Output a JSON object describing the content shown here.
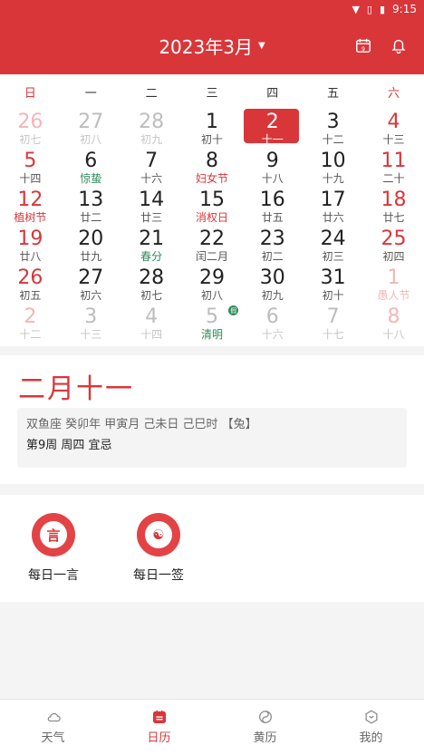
{
  "status_bar": {
    "time": "9:15"
  },
  "header": {
    "title": "2023年3月"
  },
  "weekdays": [
    "日",
    "一",
    "二",
    "三",
    "四",
    "五",
    "六"
  ],
  "calendar": {
    "rows": [
      [
        {
          "d": "26",
          "l": "初七",
          "other": true
        },
        {
          "d": "27",
          "l": "初八",
          "other": true
        },
        {
          "d": "28",
          "l": "初九",
          "other": true
        },
        {
          "d": "1",
          "l": "初十"
        },
        {
          "d": "2",
          "l": "十一",
          "selected": true
        },
        {
          "d": "3",
          "l": "十二"
        },
        {
          "d": "4",
          "l": "十三"
        }
      ],
      [
        {
          "d": "5",
          "l": "十四"
        },
        {
          "d": "6",
          "l": "惊蛰",
          "fest": "green"
        },
        {
          "d": "7",
          "l": "十六"
        },
        {
          "d": "8",
          "l": "妇女节",
          "fest": "red"
        },
        {
          "d": "9",
          "l": "十八"
        },
        {
          "d": "10",
          "l": "十九"
        },
        {
          "d": "11",
          "l": "二十"
        }
      ],
      [
        {
          "d": "12",
          "l": "植树节",
          "fest": "red"
        },
        {
          "d": "13",
          "l": "廿二"
        },
        {
          "d": "14",
          "l": "廿三"
        },
        {
          "d": "15",
          "l": "消权日",
          "fest": "red"
        },
        {
          "d": "16",
          "l": "廿五"
        },
        {
          "d": "17",
          "l": "廿六"
        },
        {
          "d": "18",
          "l": "廿七"
        }
      ],
      [
        {
          "d": "19",
          "l": "廿八"
        },
        {
          "d": "20",
          "l": "廿九"
        },
        {
          "d": "21",
          "l": "春分",
          "fest": "green"
        },
        {
          "d": "22",
          "l": "闰二月"
        },
        {
          "d": "23",
          "l": "初二"
        },
        {
          "d": "24",
          "l": "初三"
        },
        {
          "d": "25",
          "l": "初四"
        }
      ],
      [
        {
          "d": "26",
          "l": "初五"
        },
        {
          "d": "27",
          "l": "初六"
        },
        {
          "d": "28",
          "l": "初七"
        },
        {
          "d": "29",
          "l": "初八"
        },
        {
          "d": "30",
          "l": "初九"
        },
        {
          "d": "31",
          "l": "初十"
        },
        {
          "d": "1",
          "l": "愚人节",
          "other": true,
          "fest": "red"
        }
      ],
      [
        {
          "d": "2",
          "l": "十二",
          "other": true
        },
        {
          "d": "3",
          "l": "十三",
          "other": true
        },
        {
          "d": "4",
          "l": "十四",
          "other": true
        },
        {
          "d": "5",
          "l": "清明",
          "other": true,
          "fest": "green",
          "badge": "假"
        },
        {
          "d": "6",
          "l": "十六",
          "other": true
        },
        {
          "d": "7",
          "l": "十七",
          "other": true
        },
        {
          "d": "8",
          "l": "十八",
          "other": true
        }
      ]
    ]
  },
  "info": {
    "lunar_date": "二月十一",
    "line1": "双鱼座  癸卯年 甲寅月 己未日 己巳时 【兔】",
    "line2": "第9周 周四   宜忌"
  },
  "shortcuts": [
    {
      "label": "每日一言",
      "glyph": "言"
    },
    {
      "label": "每日一签",
      "glyph": "☯"
    }
  ],
  "tabs": [
    {
      "label": "天气",
      "icon": "cloud-icon"
    },
    {
      "label": "日历",
      "icon": "calendar-icon",
      "active": true
    },
    {
      "label": "黄历",
      "icon": "yinyang-icon"
    },
    {
      "label": "我的",
      "icon": "profile-icon"
    }
  ],
  "colors": {
    "accent": "#d9363a",
    "festival_green": "#2e8b57"
  }
}
